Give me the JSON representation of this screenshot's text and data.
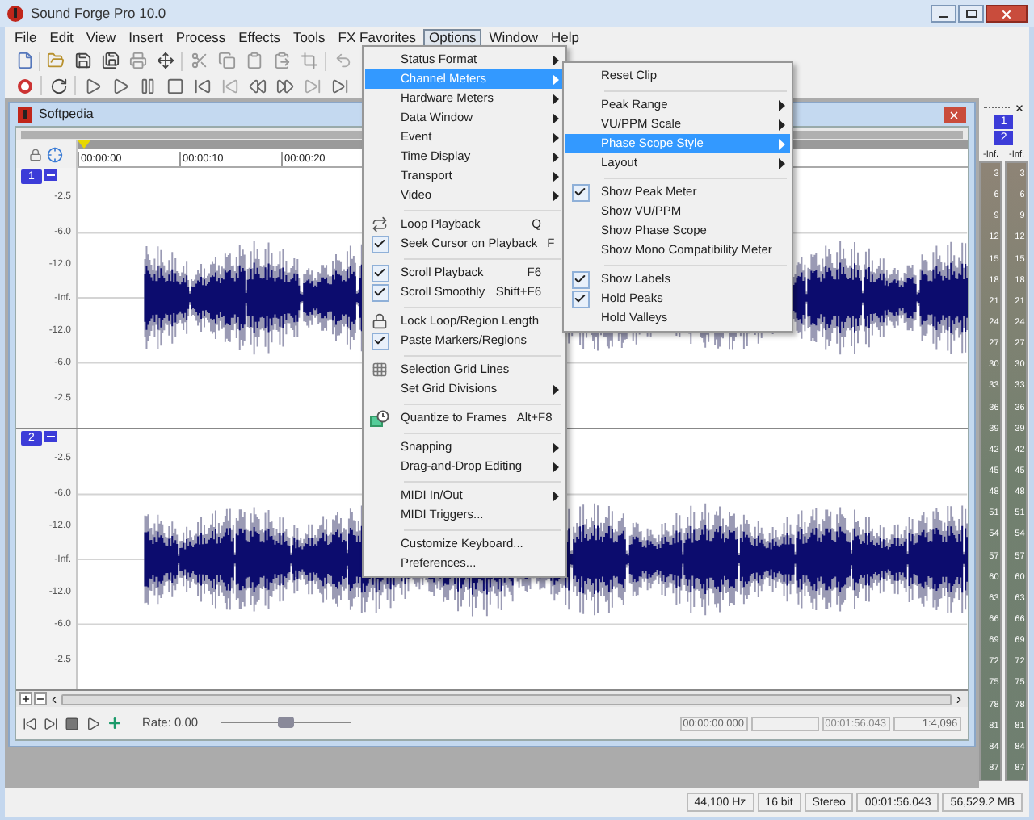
{
  "window": {
    "title": "Sound Forge Pro 10.0"
  },
  "menu_bar": [
    {
      "label": "File",
      "selected": false
    },
    {
      "label": "Edit",
      "selected": false
    },
    {
      "label": "View",
      "selected": false
    },
    {
      "label": "Insert",
      "selected": false
    },
    {
      "label": "Process",
      "selected": false
    },
    {
      "label": "Effects",
      "selected": false
    },
    {
      "label": "Tools",
      "selected": false
    },
    {
      "label": "FX Favorites",
      "selected": false
    },
    {
      "label": "Options",
      "selected": true
    },
    {
      "label": "Window",
      "selected": false
    },
    {
      "label": "Help",
      "selected": false
    }
  ],
  "options_menu": [
    {
      "kind": "submenu",
      "label": "Status Format",
      "selected": false
    },
    {
      "kind": "submenu",
      "label": "Channel Meters",
      "selected": true
    },
    {
      "kind": "submenu",
      "label": "Hardware Meters",
      "selected": false
    },
    {
      "kind": "submenu",
      "label": "Data Window",
      "selected": false
    },
    {
      "kind": "submenu",
      "label": "Event",
      "selected": false
    },
    {
      "kind": "submenu",
      "label": "Time Display",
      "selected": false
    },
    {
      "kind": "submenu",
      "label": "Transport",
      "selected": false
    },
    {
      "kind": "submenu",
      "label": "Video",
      "selected": false
    },
    {
      "kind": "separator"
    },
    {
      "kind": "loop",
      "label": "Loop Playback",
      "shortcut": "Q",
      "selected": false
    },
    {
      "kind": "toggle",
      "label": "Seek Cursor on Playback",
      "shortcut": "F",
      "checked": true,
      "selected": false
    },
    {
      "kind": "separator"
    },
    {
      "kind": "toggle",
      "label": "Scroll Playback",
      "shortcut": "F6",
      "checked": true,
      "selected": false
    },
    {
      "kind": "toggle",
      "label": "Scroll Smoothly",
      "shortcut": "Shift+F6",
      "checked": true,
      "selected": false
    },
    {
      "kind": "separator"
    },
    {
      "kind": "lock",
      "label": "Lock Loop/Region Length",
      "selected": false
    },
    {
      "kind": "toggle",
      "label": "Paste Markers/Regions",
      "checked": true,
      "selected": false
    },
    {
      "kind": "separator"
    },
    {
      "kind": "grid",
      "label": "Selection Grid Lines",
      "selected": false
    },
    {
      "kind": "submenu",
      "label": "Set Grid Divisions",
      "selected": false
    },
    {
      "kind": "separator"
    },
    {
      "kind": "quantize",
      "label": "Quantize to Frames",
      "shortcut": "Alt+F8",
      "selected": false
    },
    {
      "kind": "separator"
    },
    {
      "kind": "submenu",
      "label": "Snapping",
      "selected": false
    },
    {
      "kind": "submenu",
      "label": "Drag-and-Drop Editing",
      "selected": false
    },
    {
      "kind": "separator"
    },
    {
      "kind": "submenu",
      "label": "MIDI In/Out",
      "selected": false
    },
    {
      "kind": "plain",
      "label": "MIDI Triggers...",
      "selected": false
    },
    {
      "kind": "separator"
    },
    {
      "kind": "plain",
      "label": "Customize Keyboard...",
      "selected": false
    },
    {
      "kind": "plain",
      "label": "Preferences...",
      "selected": false
    }
  ],
  "channel_meters_menu": [
    {
      "kind": "plain",
      "label": "Reset Clip",
      "selected": false
    },
    {
      "kind": "separator"
    },
    {
      "kind": "submenu",
      "label": "Peak Range",
      "selected": false
    },
    {
      "kind": "submenu",
      "label": "VU/PPM Scale",
      "selected": false
    },
    {
      "kind": "submenu",
      "label": "Phase Scope Style",
      "selected": true
    },
    {
      "kind": "submenu",
      "label": "Layout",
      "selected": false
    },
    {
      "kind": "separator"
    },
    {
      "kind": "toggle",
      "label": "Show Peak Meter",
      "checked": true,
      "selected": false
    },
    {
      "kind": "toggle",
      "label": "Show VU/PPM",
      "checked": false,
      "selected": false
    },
    {
      "kind": "toggle",
      "label": "Show Phase Scope",
      "checked": false,
      "selected": false
    },
    {
      "kind": "toggle",
      "label": "Show Mono Compatibility Meter",
      "checked": false,
      "selected": false
    },
    {
      "kind": "separator"
    },
    {
      "kind": "toggle",
      "label": "Show Labels",
      "checked": true,
      "selected": false
    },
    {
      "kind": "toggle",
      "label": "Hold Peaks",
      "checked": true,
      "selected": false
    },
    {
      "kind": "toggle",
      "label": "Hold Valleys",
      "checked": false,
      "selected": false
    }
  ],
  "data_window": {
    "title": "Softpedia",
    "ruler": [
      "00:00:00",
      "00:00:10",
      "00:00:20"
    ],
    "tracks": [
      {
        "label": "1",
        "db_labels": [
          "-2.5",
          "-6.0",
          "-12.0",
          "-Inf.",
          "-12.0",
          "-6.0",
          "-2.5"
        ]
      },
      {
        "label": "2",
        "db_labels": [
          "-2.5",
          "-6.0",
          "-12.0",
          "-Inf.",
          "-12.0",
          "-6.0",
          "-2.5"
        ]
      }
    ],
    "rate": "Rate: 0.00",
    "rate_slider": {
      "level": 0.5
    },
    "time_fields": [
      "00:00:00.000",
      "00:01:56.043",
      "1:4,096"
    ]
  },
  "meter": {
    "buttons": [
      "1",
      "2"
    ],
    "columns": [
      {
        "reading": "-Inf.",
        "scale": [
          "3",
          "6",
          "9",
          "12",
          "15",
          "18",
          "21",
          "24",
          "27",
          "30",
          "33",
          "36",
          "39",
          "42",
          "45",
          "48",
          "51",
          "54",
          "57",
          "60",
          "63",
          "66",
          "69",
          "72",
          "75",
          "78",
          "81",
          "84",
          "87"
        ]
      },
      {
        "reading": "-Inf.",
        "scale": [
          "3",
          "6",
          "9",
          "12",
          "15",
          "18",
          "21",
          "24",
          "27",
          "30",
          "33",
          "36",
          "39",
          "42",
          "45",
          "48",
          "51",
          "54",
          "57",
          "60",
          "63",
          "66",
          "69",
          "72",
          "75",
          "78",
          "81",
          "84",
          "87"
        ]
      }
    ]
  },
  "status_bar": [
    "44,100 Hz",
    "16 bit",
    "Stereo",
    "00:01:56.043",
    "56,529.2 MB"
  ]
}
